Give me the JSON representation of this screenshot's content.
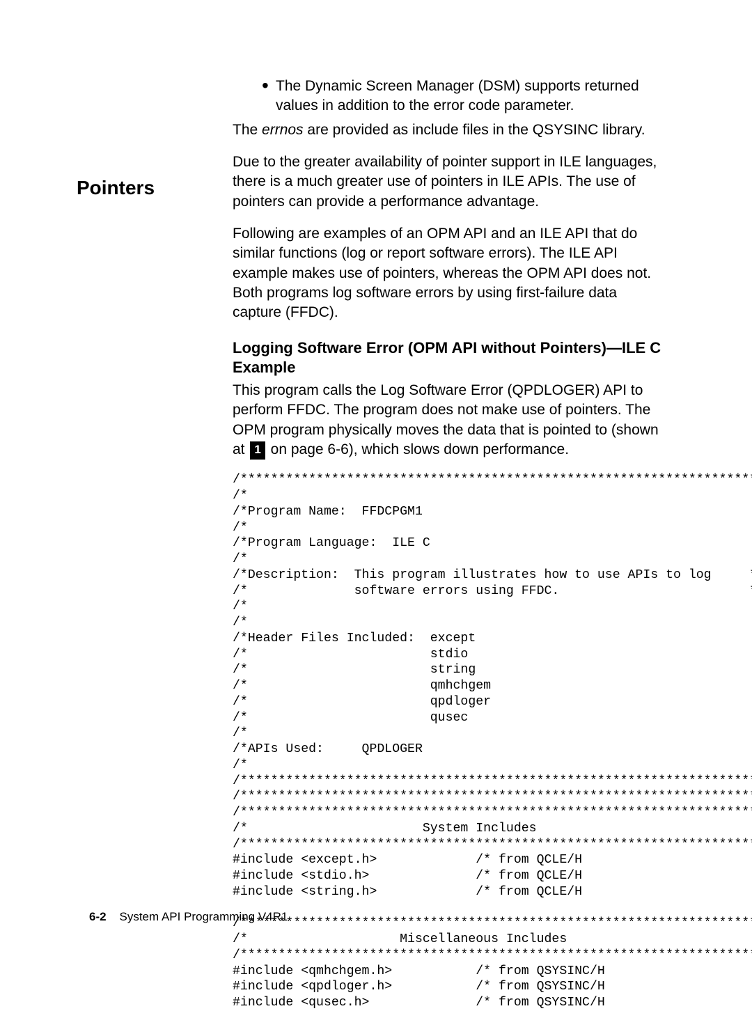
{
  "bullet1": "The Dynamic Screen Manager (DSM) supports returned values in addition to the error code parameter.",
  "para_errnos_pre": "The ",
  "para_errnos_word": "errnos",
  "para_errnos_post": " are provided as include files in the QSYSINC library.",
  "pointers_heading": "Pointers",
  "pointers_para1": "Due to the greater availability of pointer support in ILE languages, there is a much greater use of pointers in ILE APIs.  The use of pointers can provide a performance advantage.",
  "pointers_para2": "Following are examples of an OPM API and an ILE API that do similar functions (log or report software errors).  The ILE API example makes use of pointers, whereas the OPM API does not.  Both programs log software errors by using first-failure data capture (FFDC).",
  "subhead": "Logging Software Error (OPM API without Pointers)—ILE C Example",
  "sub_para_pre": "This program calls the Log Software Error (QPDLOGER) API to perform FFDC. The program does not make use of pointers.  The OPM program physically moves the data that is pointed to (shown at ",
  "inv_marker": "1",
  "sub_para_post": " on page 6-6), which slows down performance.",
  "code": "/*********************************************************************/\n/*                                                                   */\n/*Program Name:  FFDCPGM1                                            */\n/*                                                                   */\n/*Program Language:  ILE C                                           */\n/*                                                                   */\n/*Description:  This program illustrates how to use APIs to log     */\n/*              software errors using FFDC.                         */\n/*                                                                   */\n/*                                                                   */\n/*Header Files Included:  except                                     */\n/*                        stdio                                      */\n/*                        string                                     */\n/*                        qmhchgem                                   */\n/*                        qpdloger                                   */\n/*                        qusec                                      */\n/*                                                                   */\n/*APIs Used:     QPDLOGER                                            */\n/*                                                                   */\n/*********************************************************************/\n/*********************************************************************/\n/*********************************************************************/\n/*                       System Includes                             */\n/*********************************************************************/\n#include <except.h>             /* from QCLE/H                       */\n#include <stdio.h>              /* from QCLE/H                       */\n#include <string.h>             /* from QCLE/H                       */\n\n/*********************************************************************/\n/*                    Miscellaneous Includes                         */\n/*********************************************************************/\n#include <qmhchgem.h>           /* from QSYSINC/H                    */\n#include <qpdloger.h>           /* from QSYSINC/H                    */\n#include <qusec.h>              /* from QSYSINC/H                    */",
  "footer_page": "6-2",
  "footer_title": "System API Programming V4R1"
}
